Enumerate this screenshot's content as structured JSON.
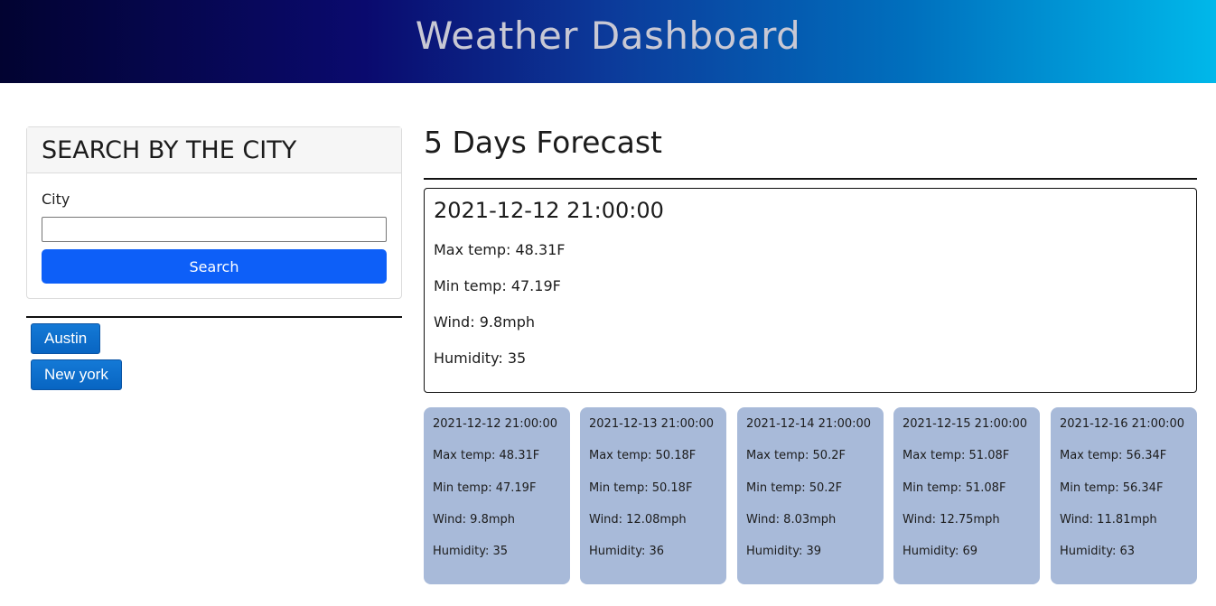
{
  "header": {
    "title": "Weather Dashboard"
  },
  "search": {
    "card_title": "SEARCH BY THE CITY",
    "city_label": "City",
    "city_value": "",
    "button_label": "Search"
  },
  "history": [
    {
      "label": "Austin"
    },
    {
      "label": "New york"
    }
  ],
  "forecast": {
    "title": "5 Days Forecast",
    "current": {
      "date": "2021-12-12 21:00:00",
      "max_temp": "Max temp: 48.31F",
      "min_temp": "Min temp: 47.19F",
      "wind": "Wind: 9.8mph",
      "humidity": "Humidity: 35"
    },
    "days": [
      {
        "date": "2021-12-12 21:00:00",
        "max_temp": "Max temp: 48.31F",
        "min_temp": "Min temp: 47.19F",
        "wind": "Wind: 9.8mph",
        "humidity": "Humidity: 35"
      },
      {
        "date": "2021-12-13 21:00:00",
        "max_temp": "Max temp: 50.18F",
        "min_temp": "Min temp: 50.18F",
        "wind": "Wind: 12.08mph",
        "humidity": "Humidity: 36"
      },
      {
        "date": "2021-12-14 21:00:00",
        "max_temp": "Max temp: 50.2F",
        "min_temp": "Min temp: 50.2F",
        "wind": "Wind: 8.03mph",
        "humidity": "Humidity: 39"
      },
      {
        "date": "2021-12-15 21:00:00",
        "max_temp": "Max temp: 51.08F",
        "min_temp": "Min temp: 51.08F",
        "wind": "Wind: 12.75mph",
        "humidity": "Humidity: 69"
      },
      {
        "date": "2021-12-16 21:00:00",
        "max_temp": "Max temp: 56.34F",
        "min_temp": "Min temp: 56.34F",
        "wind": "Wind: 11.81mph",
        "humidity": "Humidity: 63"
      }
    ]
  },
  "colors": {
    "search_button": "#0d5ff8",
    "history_button": "#0a6ccb",
    "day_card": "#a8bad9"
  }
}
